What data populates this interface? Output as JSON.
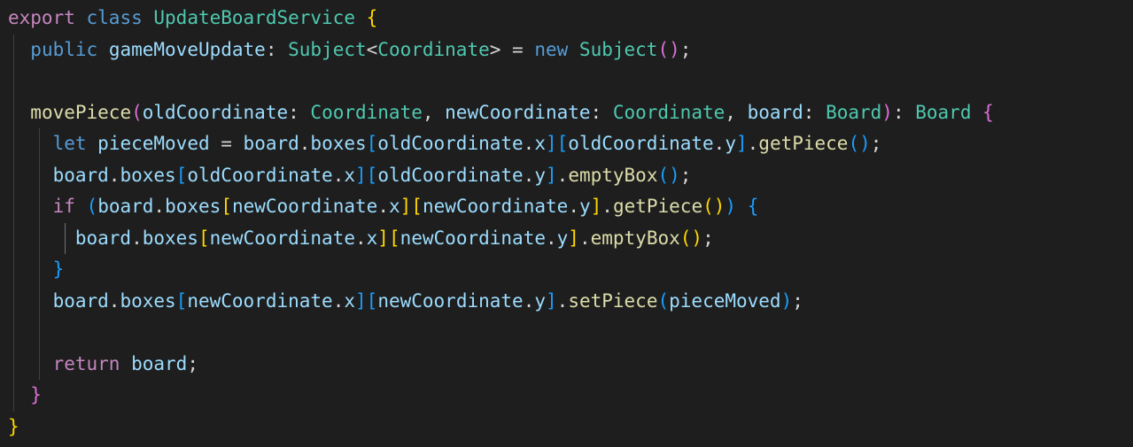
{
  "editor": {
    "lines": [
      {
        "indent": 0,
        "tokens": [
          {
            "t": "export",
            "c": "kw"
          },
          {
            "t": " "
          },
          {
            "t": "class",
            "c": "kw2"
          },
          {
            "t": " "
          },
          {
            "t": "UpdateBoardService",
            "c": "cls"
          },
          {
            "t": " "
          },
          {
            "t": "{",
            "c": "br1"
          }
        ]
      },
      {
        "indent": 1,
        "tokens": [
          {
            "t": "public",
            "c": "kw2"
          },
          {
            "t": " "
          },
          {
            "t": "gameMoveUpdate",
            "c": "var"
          },
          {
            "t": ": "
          },
          {
            "t": "Subject",
            "c": "cls"
          },
          {
            "t": "<"
          },
          {
            "t": "Coordinate",
            "c": "cls"
          },
          {
            "t": ">"
          },
          {
            "t": " = "
          },
          {
            "t": "new",
            "c": "kw2"
          },
          {
            "t": " "
          },
          {
            "t": "Subject",
            "c": "cls"
          },
          {
            "t": "()",
            "c": "br2"
          },
          {
            "t": ";"
          }
        ]
      },
      {
        "indent": 1,
        "tokens": []
      },
      {
        "indent": 1,
        "tokens": [
          {
            "t": "movePiece",
            "c": "fn"
          },
          {
            "t": "(",
            "c": "br2"
          },
          {
            "t": "oldCoordinate",
            "c": "var"
          },
          {
            "t": ": "
          },
          {
            "t": "Coordinate",
            "c": "cls"
          },
          {
            "t": ", "
          },
          {
            "t": "newCoordinate",
            "c": "var"
          },
          {
            "t": ": "
          },
          {
            "t": "Coordinate",
            "c": "cls"
          },
          {
            "t": ", "
          },
          {
            "t": "board",
            "c": "var"
          },
          {
            "t": ": "
          },
          {
            "t": "Board",
            "c": "cls"
          },
          {
            "t": ")",
            "c": "br2"
          },
          {
            "t": ": "
          },
          {
            "t": "Board",
            "c": "cls"
          },
          {
            "t": " "
          },
          {
            "t": "{",
            "c": "br2"
          }
        ]
      },
      {
        "indent": 2,
        "tokens": [
          {
            "t": "let",
            "c": "kw2"
          },
          {
            "t": " "
          },
          {
            "t": "pieceMoved",
            "c": "var"
          },
          {
            "t": " = "
          },
          {
            "t": "board",
            "c": "var"
          },
          {
            "t": "."
          },
          {
            "t": "boxes",
            "c": "var"
          },
          {
            "t": "[",
            "c": "br3"
          },
          {
            "t": "oldCoordinate",
            "c": "var"
          },
          {
            "t": "."
          },
          {
            "t": "x",
            "c": "var"
          },
          {
            "t": "]",
            "c": "br3"
          },
          {
            "t": "[",
            "c": "br3"
          },
          {
            "t": "oldCoordinate",
            "c": "var"
          },
          {
            "t": "."
          },
          {
            "t": "y",
            "c": "var"
          },
          {
            "t": "]",
            "c": "br3"
          },
          {
            "t": "."
          },
          {
            "t": "getPiece",
            "c": "fn"
          },
          {
            "t": "()",
            "c": "br3"
          },
          {
            "t": ";"
          }
        ]
      },
      {
        "indent": 2,
        "tokens": [
          {
            "t": "board",
            "c": "var"
          },
          {
            "t": "."
          },
          {
            "t": "boxes",
            "c": "var"
          },
          {
            "t": "[",
            "c": "br3"
          },
          {
            "t": "oldCoordinate",
            "c": "var"
          },
          {
            "t": "."
          },
          {
            "t": "x",
            "c": "var"
          },
          {
            "t": "]",
            "c": "br3"
          },
          {
            "t": "[",
            "c": "br3"
          },
          {
            "t": "oldCoordinate",
            "c": "var"
          },
          {
            "t": "."
          },
          {
            "t": "y",
            "c": "var"
          },
          {
            "t": "]",
            "c": "br3"
          },
          {
            "t": "."
          },
          {
            "t": "emptyBox",
            "c": "fn"
          },
          {
            "t": "()",
            "c": "br3"
          },
          {
            "t": ";"
          }
        ]
      },
      {
        "indent": 2,
        "tokens": [
          {
            "t": "if",
            "c": "kw"
          },
          {
            "t": " "
          },
          {
            "t": "(",
            "c": "br3"
          },
          {
            "t": "board",
            "c": "var"
          },
          {
            "t": "."
          },
          {
            "t": "boxes",
            "c": "var"
          },
          {
            "t": "[",
            "c": "br1"
          },
          {
            "t": "newCoordinate",
            "c": "var"
          },
          {
            "t": "."
          },
          {
            "t": "x",
            "c": "var"
          },
          {
            "t": "]",
            "c": "br1"
          },
          {
            "t": "[",
            "c": "br1"
          },
          {
            "t": "newCoordinate",
            "c": "var"
          },
          {
            "t": "."
          },
          {
            "t": "y",
            "c": "var"
          },
          {
            "t": "]",
            "c": "br1"
          },
          {
            "t": "."
          },
          {
            "t": "getPiece",
            "c": "fn"
          },
          {
            "t": "()",
            "c": "br1"
          },
          {
            "t": ")",
            "c": "br3"
          },
          {
            "t": " "
          },
          {
            "t": "{",
            "c": "br3"
          }
        ]
      },
      {
        "indent": 3,
        "tokens": [
          {
            "t": "board",
            "c": "var"
          },
          {
            "t": "."
          },
          {
            "t": "boxes",
            "c": "var"
          },
          {
            "t": "[",
            "c": "br1"
          },
          {
            "t": "newCoordinate",
            "c": "var"
          },
          {
            "t": "."
          },
          {
            "t": "x",
            "c": "var"
          },
          {
            "t": "]",
            "c": "br1"
          },
          {
            "t": "[",
            "c": "br1"
          },
          {
            "t": "newCoordinate",
            "c": "var"
          },
          {
            "t": "."
          },
          {
            "t": "y",
            "c": "var"
          },
          {
            "t": "]",
            "c": "br1"
          },
          {
            "t": "."
          },
          {
            "t": "emptyBox",
            "c": "fn"
          },
          {
            "t": "()",
            "c": "br1"
          },
          {
            "t": ";"
          }
        ]
      },
      {
        "indent": 2,
        "tokens": [
          {
            "t": "}",
            "c": "br3"
          }
        ]
      },
      {
        "indent": 2,
        "tokens": [
          {
            "t": "board",
            "c": "var"
          },
          {
            "t": "."
          },
          {
            "t": "boxes",
            "c": "var"
          },
          {
            "t": "[",
            "c": "br3"
          },
          {
            "t": "newCoordinate",
            "c": "var"
          },
          {
            "t": "."
          },
          {
            "t": "x",
            "c": "var"
          },
          {
            "t": "]",
            "c": "br3"
          },
          {
            "t": "[",
            "c": "br3"
          },
          {
            "t": "newCoordinate",
            "c": "var"
          },
          {
            "t": "."
          },
          {
            "t": "y",
            "c": "var"
          },
          {
            "t": "]",
            "c": "br3"
          },
          {
            "t": "."
          },
          {
            "t": "setPiece",
            "c": "fn"
          },
          {
            "t": "(",
            "c": "br3"
          },
          {
            "t": "pieceMoved",
            "c": "var"
          },
          {
            "t": ")",
            "c": "br3"
          },
          {
            "t": ";"
          }
        ]
      },
      {
        "indent": 2,
        "tokens": []
      },
      {
        "indent": 2,
        "tokens": [
          {
            "t": "return",
            "c": "kw"
          },
          {
            "t": " "
          },
          {
            "t": "board",
            "c": "var"
          },
          {
            "t": ";"
          }
        ]
      },
      {
        "indent": 1,
        "tokens": [
          {
            "t": "}",
            "c": "br2"
          }
        ]
      },
      {
        "indent": 0,
        "tokens": [
          {
            "t": "}",
            "c": "br1"
          }
        ]
      }
    ]
  },
  "colors": {
    "background": "#1e1e1e",
    "keyword_control": "#c586c0",
    "keyword_storage": "#569cd6",
    "type": "#4ec9b0",
    "function": "#dcdcaa",
    "variable": "#9cdcfe",
    "punctuation": "#d4d4d4",
    "bracket_level1": "#ffd700",
    "bracket_level2": "#da70d6",
    "bracket_level3": "#179fff"
  }
}
